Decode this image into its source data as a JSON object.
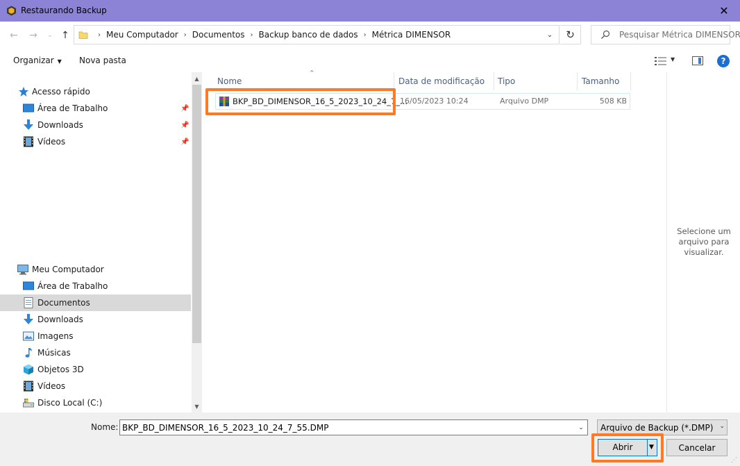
{
  "window": {
    "title": "Restaurando Backup"
  },
  "nav": {
    "breadcrumbs": [
      "Meu Computador",
      "Documentos",
      "Backup banco de dados",
      "Métrica DIMENSOR"
    ],
    "search_placeholder": "Pesquisar Métrica DIMENSOR"
  },
  "toolbar": {
    "organize_label": "Organizar",
    "new_folder_label": "Nova pasta"
  },
  "sidebar": {
    "quick_access": {
      "label": "Acesso rápido",
      "items": [
        {
          "label": "Área de Trabalho",
          "icon": "desktop-icon",
          "pinned": true
        },
        {
          "label": "Downloads",
          "icon": "downloads-icon",
          "pinned": true
        },
        {
          "label": "Vídeos",
          "icon": "videos-icon",
          "pinned": true
        }
      ]
    },
    "computer": {
      "label": "Meu Computador",
      "items": [
        {
          "label": "Área de Trabalho",
          "icon": "desktop-icon"
        },
        {
          "label": "Documentos",
          "icon": "documents-icon",
          "selected": true
        },
        {
          "label": "Downloads",
          "icon": "downloads-icon"
        },
        {
          "label": "Imagens",
          "icon": "pictures-icon"
        },
        {
          "label": "Músicas",
          "icon": "music-icon"
        },
        {
          "label": "Objetos 3D",
          "icon": "3d-objects-icon"
        },
        {
          "label": "Vídeos",
          "icon": "videos-icon"
        },
        {
          "label": "Disco Local (C:)",
          "icon": "local-disk-icon"
        }
      ]
    }
  },
  "file_list": {
    "columns": [
      "Nome",
      "Data de modificação",
      "Tipo",
      "Tamanho"
    ],
    "rows": [
      {
        "name": "BKP_BD_DIMENSOR_16_5_2023_10_24_7_...",
        "modified": "16/05/2023 10:24",
        "type": "Arquivo DMP",
        "size": "508 KB",
        "icon": "winrar-archive-icon"
      }
    ]
  },
  "preview": {
    "message": "Selecione um arquivo para visualizar."
  },
  "footer": {
    "filename_label": "Nome:",
    "filename_value": "BKP_BD_DIMENSOR_16_5_2023_10_24_7_55.DMP",
    "filetype_value": "Arquivo de Backup (*.DMP)",
    "open_label": "Abrir",
    "cancel_label": "Cancelar"
  },
  "colors": {
    "titlebar": "#8c82d6",
    "highlight": "#ff7a22",
    "selection": "#cde8ff",
    "accent": "#0078d7"
  }
}
